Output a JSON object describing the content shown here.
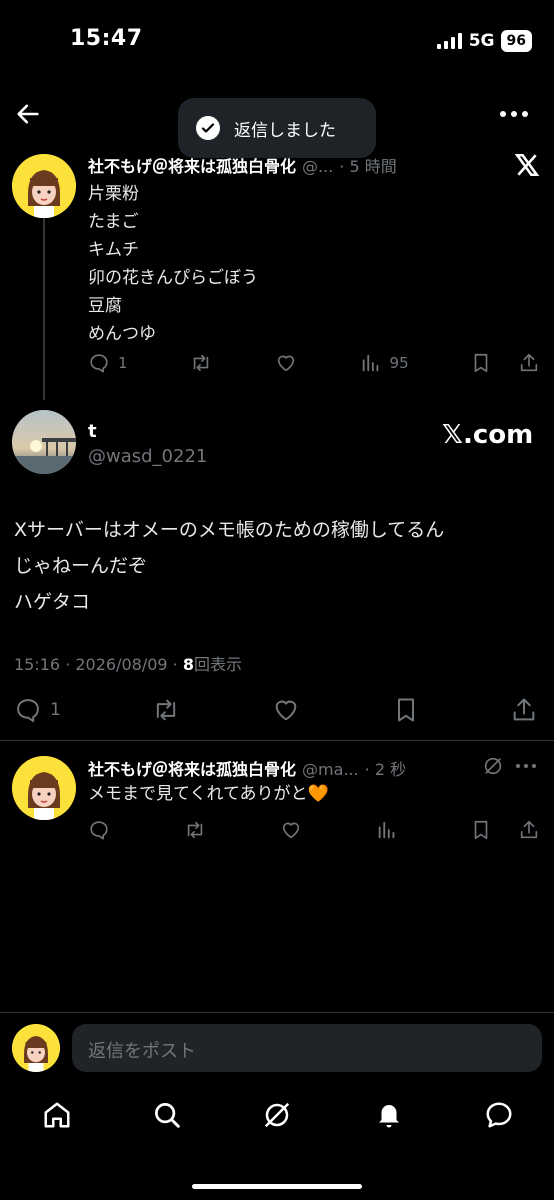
{
  "status_bar": {
    "time": "15:47",
    "network": "5G",
    "battery": "96"
  },
  "toast": {
    "text": "返信しました"
  },
  "parent_post": {
    "author_name": "社不もげ＠将来は孤独白骨化",
    "handle": "@...",
    "time": "· 5 時間",
    "lines": [
      "片栗粉",
      "たまご",
      "キムチ",
      "卯の花きんぴらごぼう",
      "豆腐",
      "めんつゆ"
    ],
    "replies": "1",
    "views": "95"
  },
  "quoted_card": {
    "author_name": "t",
    "handle": "@wasd_0221",
    "brand": "𝕏.com"
  },
  "main_post": {
    "lines": [
      "Xサーバーはオメーのメモ帳のための稼働してるん",
      "じゃねーんだぞ",
      "ハゲタコ"
    ],
    "timestamp": "15:16 · 2026/08/09 · ",
    "view_count": "8",
    "view_label": "回表示",
    "replies": "1"
  },
  "reply_post": {
    "author_name": "社不もげ＠将来は孤独白骨化",
    "handle": "@ma...",
    "time": "· 2 秒",
    "text": "メモまで見てくれてありがと🧡"
  },
  "reply_bar": {
    "placeholder": "返信をポスト"
  },
  "bottom_nav": [
    "home-icon",
    "search-icon",
    "grok-icon",
    "notifications-icon",
    "messages-icon"
  ]
}
